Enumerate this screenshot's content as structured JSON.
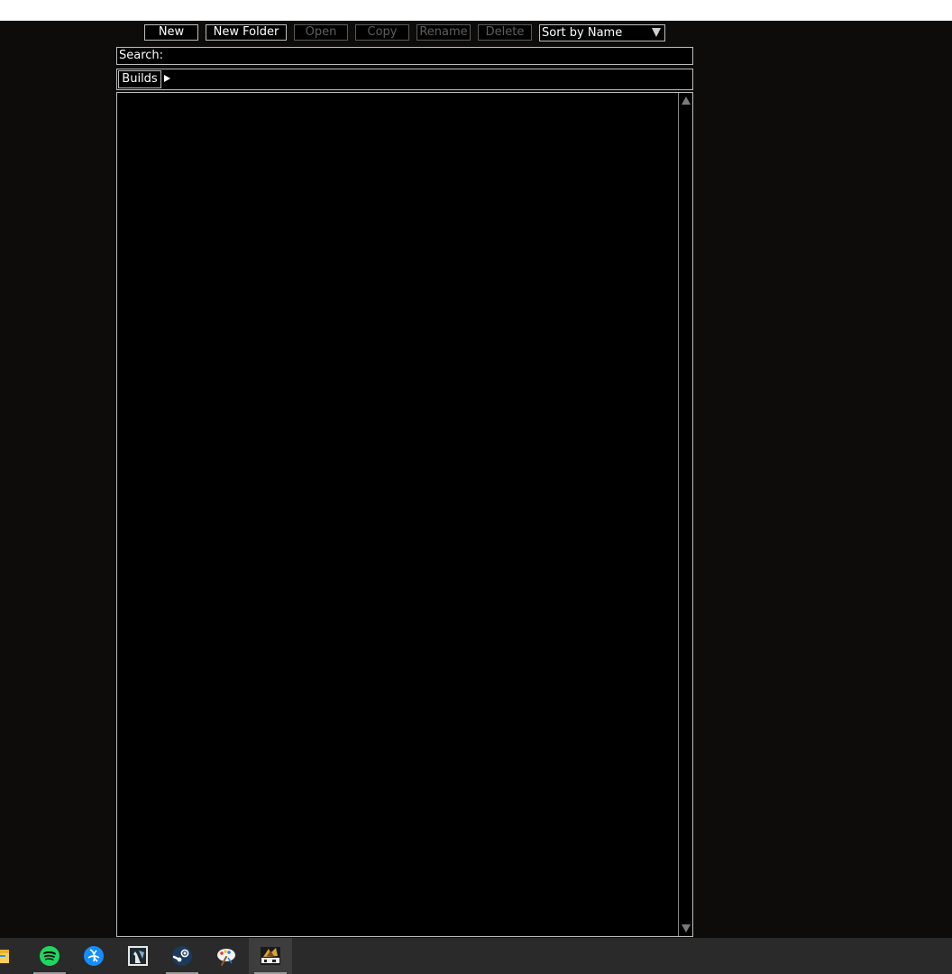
{
  "toolbar": {
    "new_label": "New",
    "new_folder_label": "New Folder",
    "open_label": "Open",
    "copy_label": "Copy",
    "rename_label": "Rename",
    "delete_label": "Delete",
    "sort_selected": "Sort by Name"
  },
  "search": {
    "label": "Search:",
    "value": ""
  },
  "breadcrumb": {
    "items": [
      "Builds"
    ]
  },
  "file_list": {
    "items": []
  },
  "taskbar": {
    "apps": [
      {
        "icon": "file-explorer-icon",
        "active": false,
        "running": false
      },
      {
        "icon": "spotify-icon",
        "active": false,
        "running": true
      },
      {
        "icon": "battle-net-icon",
        "active": false,
        "running": false
      },
      {
        "icon": "kindle-icon",
        "active": false,
        "running": false
      },
      {
        "icon": "steam-icon",
        "active": false,
        "running": true
      },
      {
        "icon": "paint-icon",
        "active": false,
        "running": false
      },
      {
        "icon": "path-of-building-icon",
        "active": true,
        "running": true
      }
    ]
  },
  "colors": {
    "background": "#0e0c0b",
    "panel": "#000000",
    "border": "#bdbdbd",
    "disabled_text": "#5e5e5e",
    "taskbar": "#2a2a2a",
    "spotify_green": "#1ed760",
    "battle_net_blue": "#148eff"
  }
}
